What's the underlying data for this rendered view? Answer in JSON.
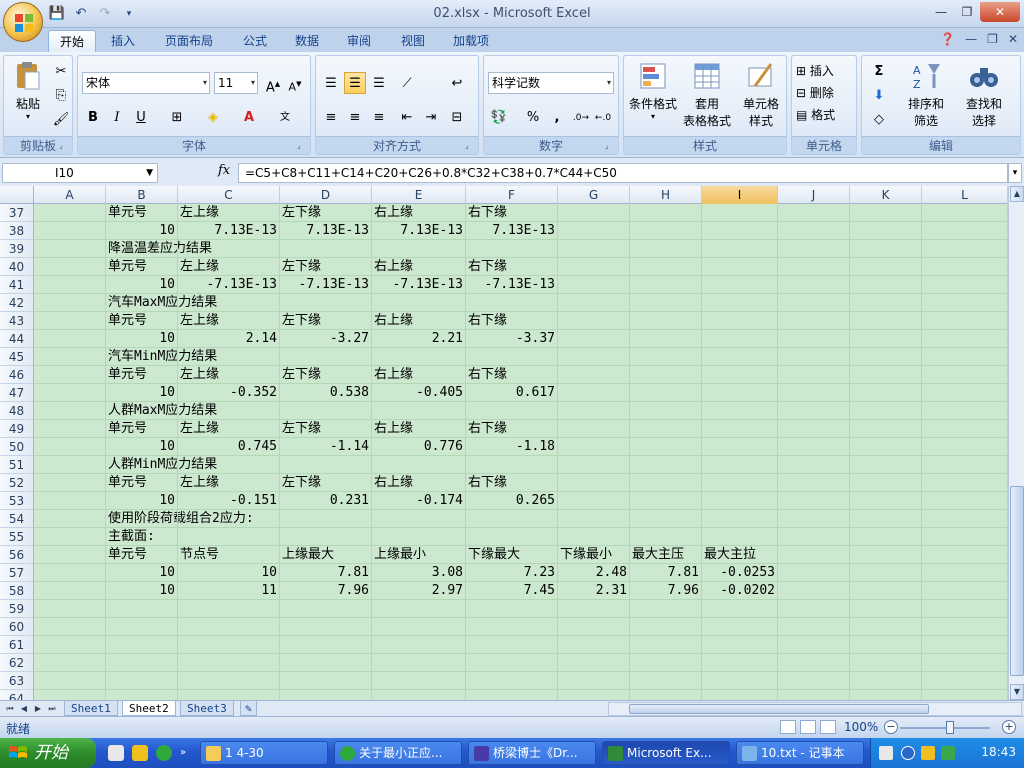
{
  "window": {
    "title": "02.xlsx - Microsoft Excel"
  },
  "tabs": [
    "开始",
    "插入",
    "页面布局",
    "公式",
    "数据",
    "审阅",
    "视图",
    "加载项"
  ],
  "ribbon": {
    "clipboard": {
      "paste": "粘贴",
      "label": "剪贴板"
    },
    "font": {
      "name": "宋体",
      "size": "11",
      "label": "字体"
    },
    "alignment": {
      "label": "对齐方式"
    },
    "number": {
      "format": "科学记数",
      "label": "数字"
    },
    "styles": {
      "conditional": "条件格式",
      "table_line1": "套用",
      "table_line2": "表格格式",
      "cell_line1": "单元格",
      "cell_line2": "样式",
      "label": "样式"
    },
    "cells": {
      "insert": "插入",
      "delete": "删除",
      "format": "格式",
      "label": "单元格"
    },
    "editing": {
      "sort_line1": "排序和",
      "sort_line2": "筛选",
      "find_line1": "查找和",
      "find_line2": "选择",
      "label": "编辑"
    }
  },
  "formula_bar": {
    "name_box": "I10",
    "fx": "fx",
    "formula": "=C5+C8+C11+C14+C20+C26+0.8*C32+C38+0.7*C44+C50"
  },
  "columns": [
    "A",
    "B",
    "C",
    "D",
    "E",
    "F",
    "G",
    "H",
    "I",
    "J",
    "K",
    "L"
  ],
  "selected_column": "I",
  "rows": [
    {
      "n": "37",
      "cells": {
        "B": "单元号",
        "C": "左上缘",
        "D": "左下缘",
        "E": "右上缘",
        "F": "右下缘"
      }
    },
    {
      "n": "38",
      "cells": {
        "B": "10",
        "C": "7.13E-13",
        "D": "7.13E-13",
        "E": "7.13E-13",
        "F": "7.13E-13"
      }
    },
    {
      "n": "39",
      "cells": {
        "B": "降温温差应力结果"
      }
    },
    {
      "n": "40",
      "cells": {
        "B": "单元号",
        "C": "左上缘",
        "D": "左下缘",
        "E": "右上缘",
        "F": "右下缘"
      }
    },
    {
      "n": "41",
      "cells": {
        "B": "10",
        "C": "-7.13E-13",
        "D": "-7.13E-13",
        "E": "-7.13E-13",
        "F": "-7.13E-13"
      }
    },
    {
      "n": "42",
      "cells": {
        "B": "汽车MaxM应力结果"
      }
    },
    {
      "n": "43",
      "cells": {
        "B": "单元号",
        "C": "左上缘",
        "D": "左下缘",
        "E": "右上缘",
        "F": "右下缘"
      }
    },
    {
      "n": "44",
      "cells": {
        "B": "10",
        "C": "2.14",
        "D": "-3.27",
        "E": "2.21",
        "F": "-3.37"
      }
    },
    {
      "n": "45",
      "cells": {
        "B": "汽车MinM应力结果"
      }
    },
    {
      "n": "46",
      "cells": {
        "B": "单元号",
        "C": "左上缘",
        "D": "左下缘",
        "E": "右上缘",
        "F": "右下缘"
      }
    },
    {
      "n": "47",
      "cells": {
        "B": "10",
        "C": "-0.352",
        "D": "0.538",
        "E": "-0.405",
        "F": "0.617"
      }
    },
    {
      "n": "48",
      "cells": {
        "B": "人群MaxM应力结果"
      }
    },
    {
      "n": "49",
      "cells": {
        "B": "单元号",
        "C": "左上缘",
        "D": "左下缘",
        "E": "右上缘",
        "F": "右下缘"
      }
    },
    {
      "n": "50",
      "cells": {
        "B": "10",
        "C": "0.745",
        "D": "-1.14",
        "E": "0.776",
        "F": "-1.18"
      }
    },
    {
      "n": "51",
      "cells": {
        "B": "人群MinM应力结果"
      }
    },
    {
      "n": "52",
      "cells": {
        "B": "单元号",
        "C": "左上缘",
        "D": "左下缘",
        "E": "右上缘",
        "F": "右下缘"
      }
    },
    {
      "n": "53",
      "cells": {
        "B": "10",
        "C": "-0.151",
        "D": "0.231",
        "E": "-0.174",
        "F": "0.265"
      }
    },
    {
      "n": "54",
      "cells": {
        "B": "使用阶段荷载组合2应力:"
      }
    },
    {
      "n": "55",
      "cells": {
        "B": "主截面:"
      }
    },
    {
      "n": "56",
      "cells": {
        "B": "单元号",
        "C": "节点号",
        "D": "上缘最大",
        "E": "上缘最小",
        "F": "下缘最大",
        "G": "下缘最小",
        "H": "最大主压",
        "I": "最大主拉"
      }
    },
    {
      "n": "57",
      "cells": {
        "B": "10",
        "C": "10",
        "D": "7.81",
        "E": "3.08",
        "F": "7.23",
        "G": "2.48",
        "H": "7.81",
        "I": "-0.0253"
      }
    },
    {
      "n": "58",
      "cells": {
        "B": "10",
        "C": "11",
        "D": "7.96",
        "E": "2.97",
        "F": "7.45",
        "G": "2.31",
        "H": "7.96",
        "I": "-0.0202"
      }
    },
    {
      "n": "59",
      "cells": {}
    },
    {
      "n": "60",
      "cells": {}
    },
    {
      "n": "61",
      "cells": {}
    },
    {
      "n": "62",
      "cells": {}
    },
    {
      "n": "63",
      "cells": {}
    },
    {
      "n": "64",
      "cells": {}
    }
  ],
  "sheets": [
    "Sheet1",
    "Sheet2",
    "Sheet3"
  ],
  "active_sheet": "Sheet2",
  "status": {
    "text": "就绪",
    "zoom": "100%"
  },
  "taskbar": {
    "start": "开始",
    "tasks": [
      "1 4-30",
      "关于最小正应...",
      "桥梁博士《Dr...",
      "Microsoft Ex...",
      "10.txt - 记事本"
    ],
    "active_task": "Microsoft Ex...",
    "clock": "18:43"
  },
  "colors": {
    "grid_bg": "#cce8cf",
    "ribbon_bg": "#dbe7f6",
    "taskbar": "#2457cc",
    "start": "#2d8c2a"
  }
}
